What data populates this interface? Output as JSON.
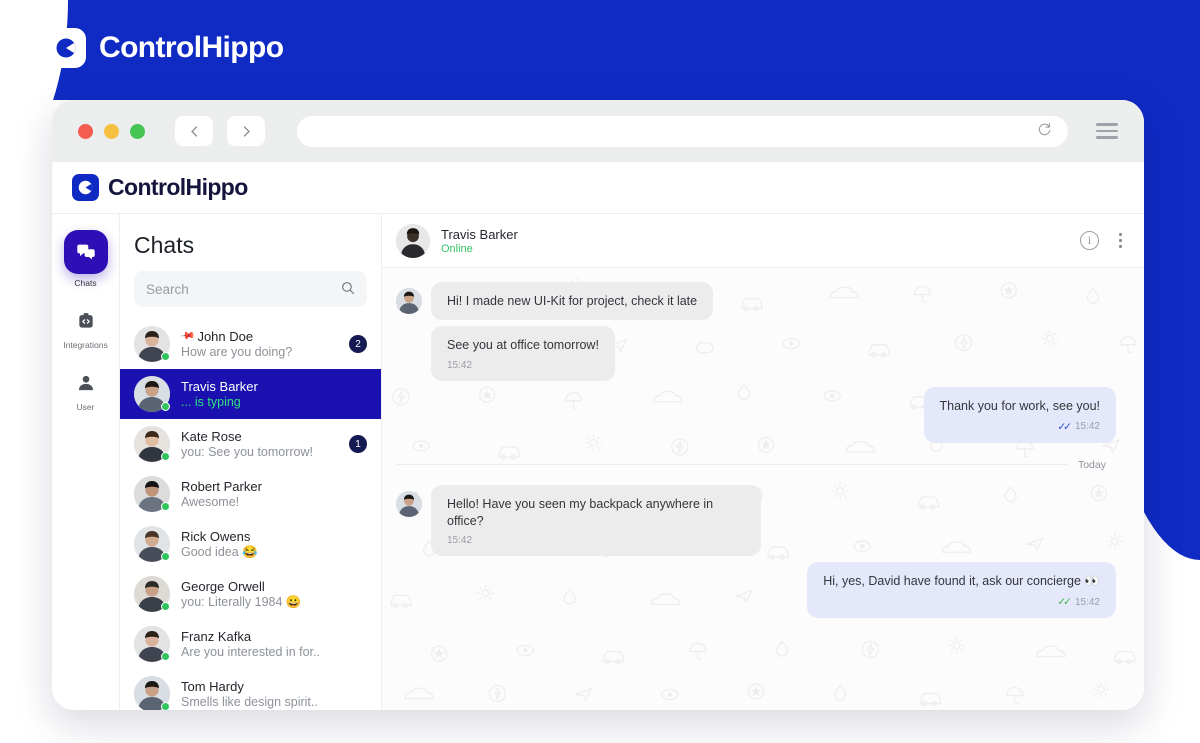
{
  "brand": {
    "name": "ControlHippo",
    "logo_icon": "controlhippo-logo-icon",
    "accent": "#0f2bc4"
  },
  "browser": {
    "traffic_lights": [
      "close",
      "minimize",
      "zoom"
    ],
    "back_icon": "chevron-left-icon",
    "forward_icon": "chevron-right-icon",
    "url_value": "",
    "url_placeholder": "",
    "reload_icon": "reload-icon",
    "menu_icon": "hamburger-menu-icon"
  },
  "app_header": {
    "brand_name": "ControlHippo"
  },
  "rail": {
    "items": [
      {
        "label": "Chats",
        "icon": "chat-bubbles-icon",
        "active": true
      },
      {
        "label": "Integrations",
        "icon": "code-brackets-icon",
        "active": false
      },
      {
        "label": "User",
        "icon": "person-icon",
        "active": false
      }
    ]
  },
  "chatlist": {
    "title": "Chats",
    "search": {
      "value": "",
      "placeholder": "Search",
      "icon": "search-icon"
    },
    "rows": [
      {
        "name": "John Doe",
        "snippet": "How are you doing?",
        "badge": "2",
        "pinned": true,
        "online": true,
        "selected": false,
        "typing": false,
        "avatar": "#6e6b68"
      },
      {
        "name": "Travis Barker",
        "snippet": "... is typing",
        "badge": "",
        "pinned": false,
        "online": true,
        "selected": true,
        "typing": true,
        "avatar": "#8a6a52"
      },
      {
        "name": "Kate Rose",
        "snippet": "you: See you tomorrow!",
        "badge": "1",
        "pinned": false,
        "online": true,
        "selected": false,
        "typing": false,
        "avatar": "#c8a08c"
      },
      {
        "name": "Robert Parker",
        "snippet": "Awesome!",
        "badge": "",
        "pinned": false,
        "online": true,
        "selected": false,
        "typing": false,
        "avatar": "#7a98b8"
      },
      {
        "name": "Rick Owens",
        "snippet": "Good idea 😂",
        "badge": "",
        "pinned": false,
        "online": true,
        "selected": false,
        "typing": false,
        "avatar": "#6f7a5e"
      },
      {
        "name": "George Orwell",
        "snippet": "you: Literally 1984 😀",
        "badge": "",
        "pinned": false,
        "online": true,
        "selected": false,
        "typing": false,
        "avatar": "#5d5b58"
      },
      {
        "name": "Franz Kafka",
        "snippet": "Are you interested in for..",
        "badge": "",
        "pinned": false,
        "online": true,
        "selected": false,
        "typing": false,
        "avatar": "#8d8b86"
      },
      {
        "name": "Tom Hardy",
        "snippet": "Smells like design spirit..",
        "badge": "",
        "pinned": false,
        "online": true,
        "selected": false,
        "typing": false,
        "avatar": "#6b6558"
      }
    ]
  },
  "conversation": {
    "contact_name": "Travis Barker",
    "status": "Online",
    "info_icon": "info-circle-icon",
    "menu_icon": "more-vertical-icon",
    "day_divider": "Today",
    "messages": [
      {
        "direction": "in",
        "text": "Hi! I made new UI-Kit for project, check it late",
        "time": "",
        "ticks": "",
        "show_avatar": true
      },
      {
        "direction": "in",
        "text": "See you at office tomorrow!",
        "time": "15:42",
        "ticks": "",
        "show_avatar": false
      },
      {
        "direction": "out",
        "text": "Thank you for work, see you!",
        "time": "15:42",
        "ticks": "read-blue",
        "show_avatar": false
      },
      {
        "direction": "in",
        "text": "Hello! Have you seen my backpack anywhere in office?",
        "time": "15:42",
        "ticks": "",
        "show_avatar": true,
        "after_divider": true
      },
      {
        "direction": "out",
        "text": "Hi, yes, David have found it, ask our concierge 👀",
        "time": "15:42",
        "ticks": "read-green",
        "show_avatar": false
      }
    ]
  }
}
